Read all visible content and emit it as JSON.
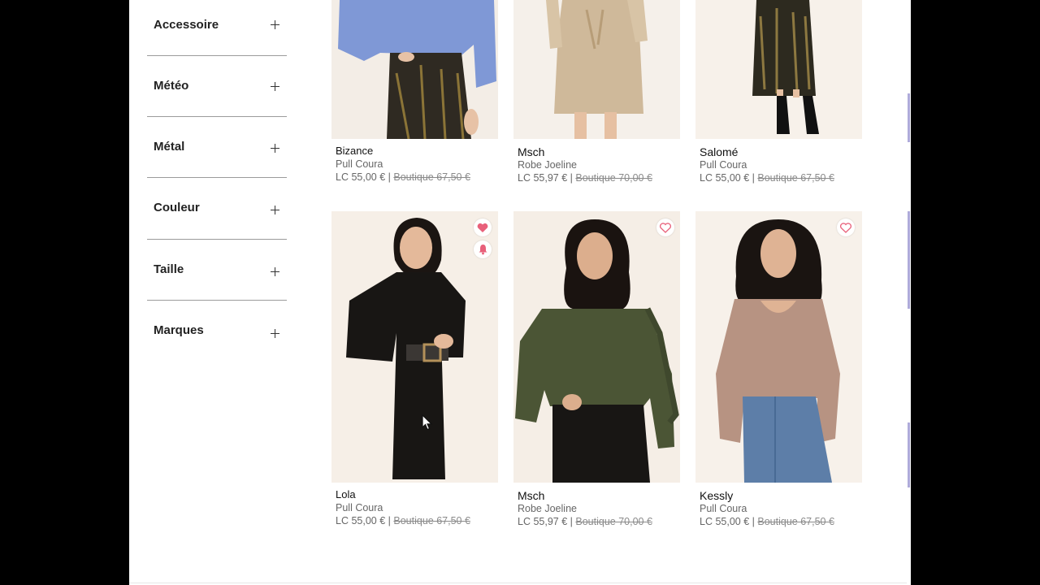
{
  "filters": [
    {
      "label": "Accessoire"
    },
    {
      "label": "Météo"
    },
    {
      "label": "Métal"
    },
    {
      "label": "Couleur"
    },
    {
      "label": "Taille"
    },
    {
      "label": "Marques"
    }
  ],
  "products": [
    {
      "brand": "Bizance",
      "model": "Pull Coura",
      "price": "LC 55,00 €",
      "separator": "|",
      "boutique_price": "Boutique 67,50 €"
    },
    {
      "brand": "Msch",
      "model": "Robe Joeline",
      "price": "LC 55,97 €",
      "separator": "|",
      "boutique_price": "Boutique 70,00 €"
    },
    {
      "brand": "Salomé",
      "model": "Pull Coura",
      "price": "LC 55,00 €",
      "separator": "|",
      "boutique_price": "Boutique 67,50 €"
    },
    {
      "brand": "Lola",
      "model": "Pull Coura",
      "price": "LC 55,00 €",
      "separator": "|",
      "boutique_price": "Boutique 67,50 €",
      "favorited": true,
      "alert": true
    },
    {
      "brand": "Msch",
      "model": "Robe Joeline",
      "price": "LC 55,97 €",
      "separator": "|",
      "boutique_price": "Boutique 70,00 €",
      "favorited": false
    },
    {
      "brand": "Kessly",
      "model": "Pull Coura",
      "price": "LC 55,00 €",
      "separator": "|",
      "boutique_price": "Boutique 67,50 €",
      "favorited": false
    }
  ],
  "icons": {
    "filter_expand": "plus-icon",
    "favorite": "heart-icon",
    "alert": "bell-icon"
  },
  "colors": {
    "favorite_accent": "#e8607a",
    "price_text": "#666666",
    "divider": "#9b9b9b"
  }
}
